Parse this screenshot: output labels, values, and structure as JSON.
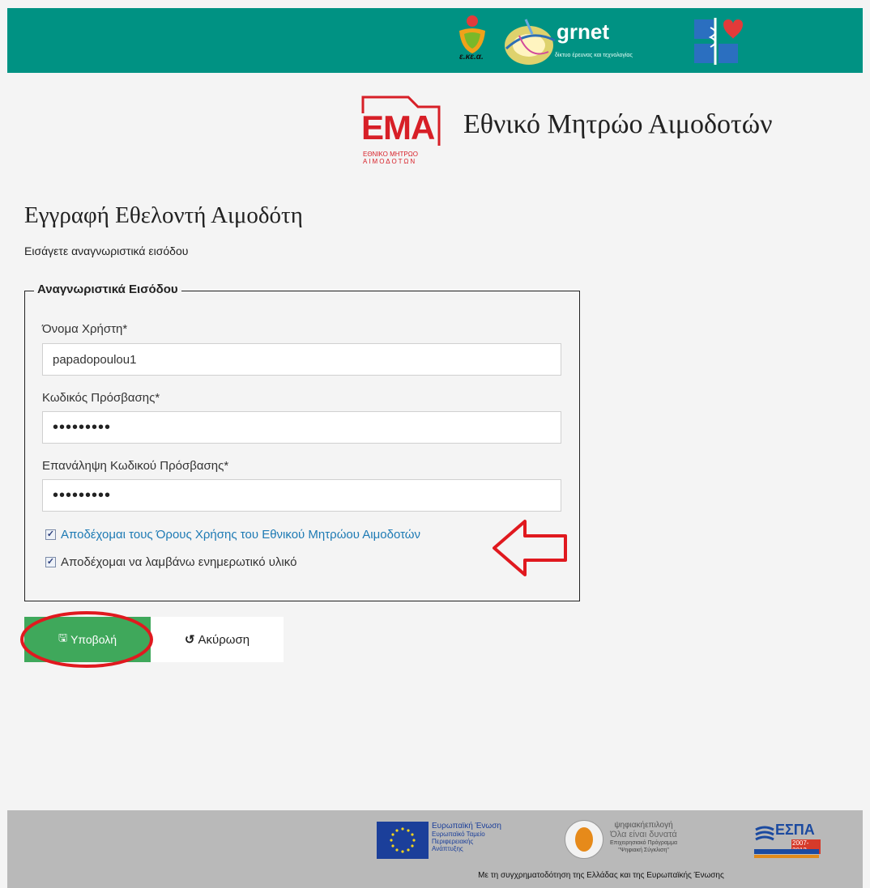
{
  "header": {
    "logos": {
      "ekea_label": "ε.κε.α.",
      "grnet_label": "grnet",
      "grnet_tagline": "δίκτυο έρευνας και τεχνολογίας"
    }
  },
  "brand": {
    "logo_text": "EMA",
    "logo_subtext_1": "ΕΘΝΙΚΟ ΜΗΤΡΩΟ",
    "logo_subtext_2": "ΑΙΜΟΔΟΤΩΝ",
    "title": "Εθνικό Μητρώο Αιμοδοτών"
  },
  "page": {
    "title": "Εγγραφή Εθελοντή Αιμοδότη",
    "subtitle": "Εισάγετε αναγνωριστικά εισόδου"
  },
  "form": {
    "legend": "Αναγνωριστικά Εισόδου",
    "username_label": "Όνομα Χρήστη*",
    "username_value": "papadopoulou1",
    "password_label": "Κωδικός Πρόσβασης*",
    "password_value": "•••••••••",
    "password_repeat_label": "Επανάληψη Κωδικού Πρόσβασης*",
    "password_repeat_value": "•••••••••",
    "terms_label": "Αποδέχομαι τους Όρους Χρήσης του Εθνικού Μητρώου Αιμοδοτών",
    "terms_checked": true,
    "newsletter_label": "Αποδέχομαι να λαμβάνω ενημερωτικό υλικό",
    "newsletter_checked": true
  },
  "actions": {
    "submit_label": "Υποβολή",
    "cancel_label": "Ακύρωση"
  },
  "footer": {
    "eu_title": "Ευρωπαϊκή Ένωση",
    "eu_subtitle_1": "Ευρωπαϊκό Ταμείο",
    "eu_subtitle_2": "Περιφερειακής",
    "eu_subtitle_3": "Ανάπτυξης",
    "digital_title": "ψηφιακήεπιλογή",
    "digital_subtitle": "Όλα είναι δυνατά",
    "digital_small_1": "Επιχειρησιακό Πρόγραμμα",
    "digital_small_2": "\"Ψηφιακή Σύγκλιση\"",
    "espa_title": "ΕΣΠΑ",
    "espa_years": "2007-2013",
    "caption": "Με τη συγχρηματοδότηση της Ελλάδας και της Ευρωπαϊκής Ένωσης"
  },
  "colors": {
    "topbar": "#009283",
    "submit": "#3fa85b",
    "link": "#1d7ab4",
    "annotation": "#e0191f"
  }
}
